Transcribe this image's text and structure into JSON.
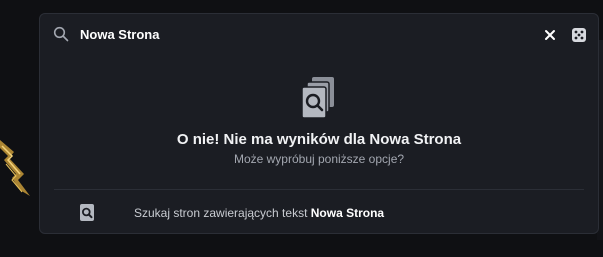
{
  "search": {
    "value": "Nowa Strona",
    "search_icon": "search-icon",
    "clear_icon": "close-icon",
    "random_icon": "dice-icon"
  },
  "empty_state": {
    "icon": "pages-search-icon",
    "title": "O nie! Nie ma wyników dla Nowa Strona",
    "subtitle": "Może wypróbuj poniższe opcje?"
  },
  "suggestion": {
    "icon": "page-search-icon",
    "prefix": "Szukaj stron zawierających tekst ",
    "query": "Nowa Strona"
  },
  "colors": {
    "background": "#0f1013",
    "panel": "#1b1d23",
    "border": "#2b2e36",
    "text": "#e6e7ea",
    "muted": "#a3a7b0"
  }
}
